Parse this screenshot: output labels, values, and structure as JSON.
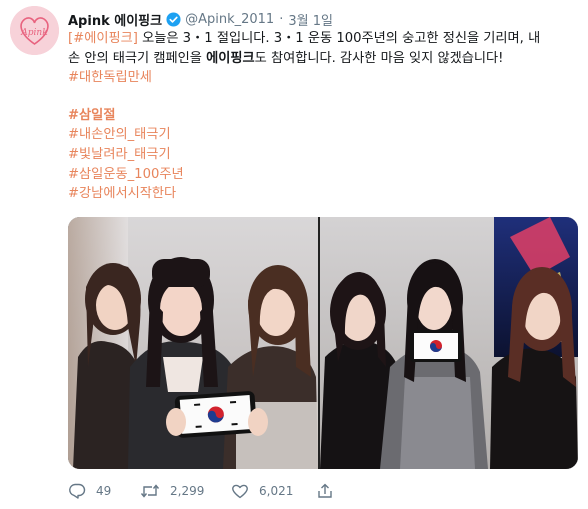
{
  "tweet": {
    "display_name": "Apink 에이핑크",
    "handle": "@Apink_2011",
    "separator": "·",
    "date": "3월 1일",
    "avatar_text": "Apink",
    "lines": {
      "l1_hash": "[#에이핑크]",
      "l1_text": " 오늘은 3・1 절입니다. 3・1 운동 100주년의 숭고한 정신을 기리며, 내",
      "l2_pre": "손 안의 태극기 캠페인을 ",
      "l2_bold": "에이핑크",
      "l2_post": "도 참여합니다. 감사한 마음 잊지 않겠습니다!",
      "l3_hash": "#대한독립만세"
    },
    "hashtags": {
      "h1": "#삼일절",
      "h2": "#내손안의_태극기",
      "h3": "#빛날려라_태극기",
      "h4": "#삼일운동_100주년",
      "h5": "#강남에서시작한다"
    },
    "actions": {
      "reply_count": "49",
      "retweet_count": "2,299",
      "like_count": "6,021"
    }
  },
  "colors": {
    "hashtag": "#e8855c",
    "meta": "#657786",
    "verified": "#1da1f2",
    "brand_pink": "#e8637f"
  },
  "icons": [
    "verified-badge-icon",
    "reply-icon",
    "retweet-icon",
    "like-icon",
    "share-icon"
  ]
}
